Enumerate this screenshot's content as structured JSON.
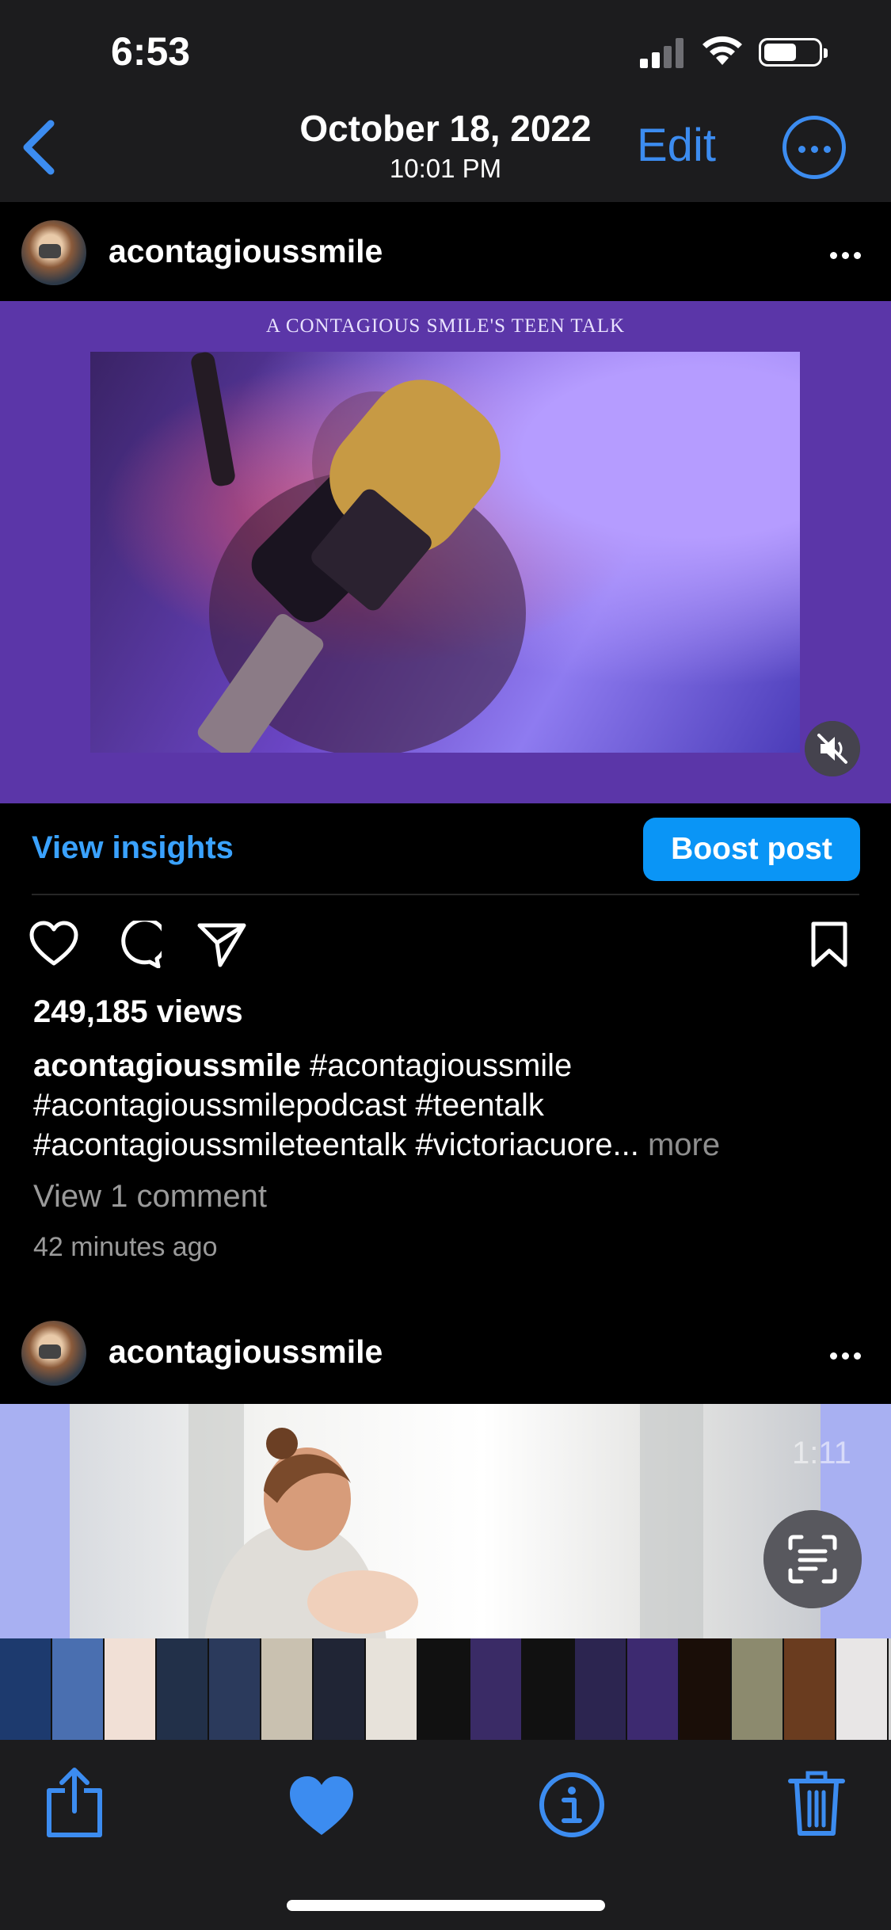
{
  "status_bar": {
    "time": "6:53"
  },
  "header": {
    "date": "October 18, 2022",
    "time": "10:01 PM",
    "edit_label": "Edit"
  },
  "post1": {
    "username": "acontagioussmile",
    "media_title": "A CONTAGIOUS SMILE'S TEEN TALK",
    "insights_label": "View insights",
    "boost_label": "Boost post",
    "views": "249,185 views",
    "caption_user": "acontagioussmile",
    "caption_line1": " #acontagioussmile",
    "caption_line2": "#acontagioussmilepodcast #teentalk",
    "caption_line3": "#acontagioussmileteentalk #victoriacuore...",
    "more_label": " more",
    "comments_label": "View 1 comment",
    "time_ago": "42 minutes ago"
  },
  "post2": {
    "username": "acontagioussmile",
    "duration": "1:11"
  },
  "colors": {
    "accent": "#3c8cf0",
    "boost": "#0a95f6",
    "link": "#3aa2ff",
    "media_bg": "#5b36a8"
  },
  "thumbnails": [
    "#1d3a6e",
    "#4a6fb0",
    "#f1e0d6",
    "#223049",
    "#2b3a5c",
    "#c9c1b0",
    "#202535",
    "#e7e2da",
    "#111111",
    "#3a2b66",
    "#111111",
    "#2c2550",
    "#3d2a70",
    "#1a0e08",
    "#8c8a6e",
    "#6a3c1f",
    "#e8e6e6",
    "#cfcfcf",
    "#2a2a55"
  ]
}
